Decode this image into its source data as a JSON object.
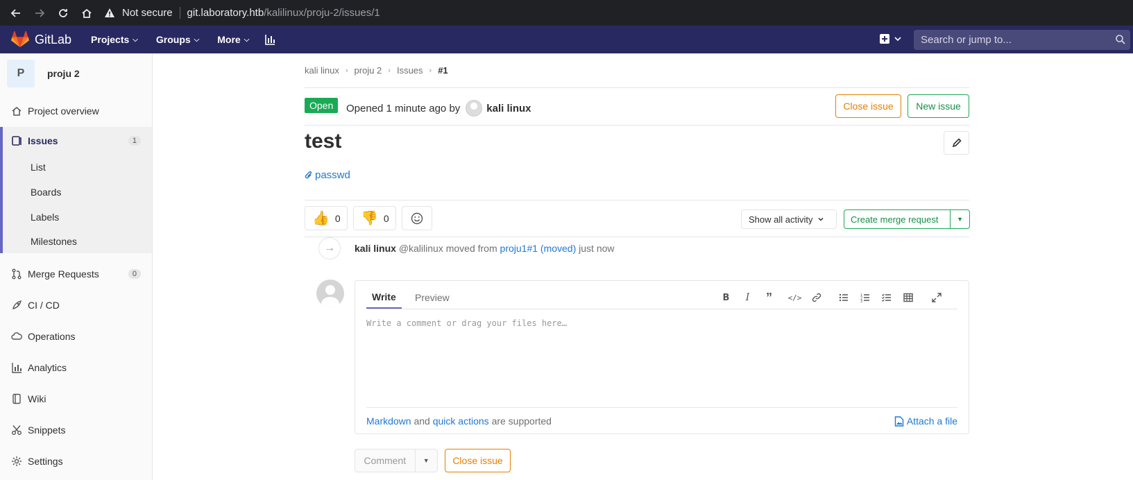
{
  "browser": {
    "security_label": "Not secure",
    "url_host": "git.laboratory.htb",
    "url_path": "/kalilinux/proju-2/issues/1"
  },
  "navbar": {
    "brand": "GitLab",
    "items": [
      {
        "label": "Projects"
      },
      {
        "label": "Groups"
      },
      {
        "label": "More"
      }
    ],
    "search_placeholder": "Search or jump to..."
  },
  "sidebar": {
    "project_initial": "P",
    "project_name": "proju 2",
    "items": [
      {
        "label": "Project overview"
      },
      {
        "label": "Issues",
        "count": "1"
      },
      {
        "label": "Merge Requests",
        "count": "0"
      },
      {
        "label": "CI / CD"
      },
      {
        "label": "Operations"
      },
      {
        "label": "Analytics"
      },
      {
        "label": "Wiki"
      },
      {
        "label": "Snippets"
      },
      {
        "label": "Settings"
      }
    ],
    "issues_sub": [
      {
        "label": "List"
      },
      {
        "label": "Boards"
      },
      {
        "label": "Labels"
      },
      {
        "label": "Milestones"
      }
    ]
  },
  "breadcrumb": [
    "kali linux",
    "proju 2",
    "Issues",
    "#1"
  ],
  "issue": {
    "status": "Open",
    "opened_text": "Opened 1 minute ago by",
    "author": "kali linux",
    "close_label": "Close issue",
    "new_label": "New issue",
    "title": "test",
    "attachment": "passwd"
  },
  "awards": {
    "thumbs_up": "0",
    "thumbs_down": "0"
  },
  "activity": {
    "filter_label": "Show all activity",
    "merge_request_label": "Create merge request"
  },
  "note": {
    "author": "kali linux",
    "handle": "@kalilinux",
    "action": "moved from",
    "link": "proju1#1 (moved)",
    "time": "just now"
  },
  "editor": {
    "tab_write": "Write",
    "tab_preview": "Preview",
    "placeholder": "Write a comment or drag your files here…",
    "markdown_link": "Markdown",
    "and_text": "and",
    "quick_actions_link": "quick actions",
    "supported_text": "are supported",
    "attach_label": "Attach a file"
  },
  "footer_actions": {
    "comment_label": "Comment",
    "close_label": "Close issue"
  },
  "colors": {
    "navbar": "#292961",
    "success": "#1aaa55",
    "warning": "#e67e00",
    "link": "#1f78d1"
  }
}
